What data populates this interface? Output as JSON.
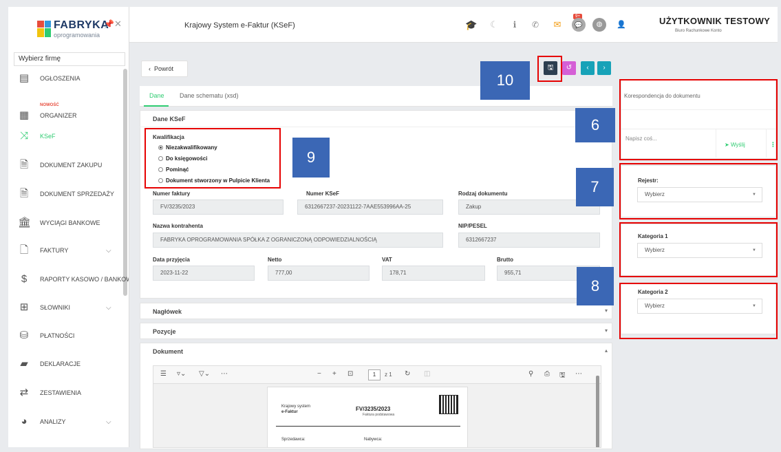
{
  "sidebar": {
    "logo_title": "FABRYKA",
    "logo_subtitle": "oprogramowania",
    "firm_select_placeholder": "Wybierz firmę",
    "items": [
      {
        "label": "OGŁOSZENIA",
        "icon": "newspaper-icon"
      },
      {
        "label": "ORGANIZER",
        "icon": "calendar-icon",
        "new_badge": "NOWOŚĆ"
      },
      {
        "label": "KSeF",
        "icon": "shuffle-icon"
      },
      {
        "label": "DOKUMENT ZAKUPU",
        "icon": "document-icon"
      },
      {
        "label": "DOKUMENT SPRZEDAŻY",
        "icon": "document-icon"
      },
      {
        "label": "WYCIĄGI BANKOWE",
        "icon": "bank-icon"
      },
      {
        "label": "FAKTURY",
        "icon": "file-icon"
      },
      {
        "label": "RAPORTY KASOWO / BANKOWE",
        "icon": "dollar-icon"
      },
      {
        "label": "SŁOWNIKI",
        "icon": "table-icon"
      },
      {
        "label": "PŁATNOŚCI",
        "icon": "coins-icon"
      },
      {
        "label": "DEKLARACJE",
        "icon": "book-icon"
      },
      {
        "label": "ZESTAWIENIA",
        "icon": "exchange-icon"
      },
      {
        "label": "ANALIZY",
        "icon": "pie-chart-icon"
      }
    ]
  },
  "header": {
    "title": "Krajowy System e-Faktur (KSeF)",
    "mail_badge": "9+",
    "user_name": "UŻYTKOWNIK TESTOWY",
    "user_subtitle": "Biuro Rachunkowe Konto"
  },
  "toolbar": {
    "back_label": "Powrót"
  },
  "tabs": [
    {
      "label": "Dane",
      "active": true
    },
    {
      "label": "Dane schematu (xsd)",
      "active": false
    }
  ],
  "ksef": {
    "section_title": "Dane KSeF",
    "kwalifikacja_label": "Kwalifikacja",
    "options": [
      {
        "label": "Niezakwalifikowany",
        "selected": true
      },
      {
        "label": "Do księgowości",
        "selected": false
      },
      {
        "label": "Pominąć",
        "selected": false
      },
      {
        "label": "Dokument stworzony w Pulpicie Klienta",
        "selected": false
      }
    ],
    "numer_faktury_label": "Numer faktury",
    "numer_faktury": "FV/3235/2023",
    "numer_ksef_label": "Numer KSeF",
    "numer_ksef": "6312667237-20231122-7AAE553996AA-25",
    "rodzaj_label": "Rodzaj dokumentu",
    "rodzaj": "Zakup",
    "kontrahent_label": "Nazwa kontrahenta",
    "kontrahent": "FABRYKA OPROGRAMOWANIA SPÓŁKA Z OGRANICZONĄ ODPOWIEDZIALNOŚCIĄ",
    "nip_label": "NIP/PESEL",
    "nip": "6312667237",
    "data_label": "Data przyjęcia",
    "data": "2023-11-22",
    "netto_label": "Netto",
    "netto": "777,00",
    "vat_label": "VAT",
    "vat": "178,71",
    "brutto_label": "Brutto",
    "brutto": "955,71"
  },
  "sections": {
    "naglowek": "Nagłówek",
    "pozycje": "Pozycje",
    "dokument": "Dokument"
  },
  "pdf": {
    "page_number": "1",
    "page_of": "z 1",
    "doc_type_line1": "Krajowy system",
    "doc_type_line2": "e-Faktur",
    "invoice_no": "FV/3235/2023",
    "invoice_kind": "Faktura podstawowa",
    "seller_label": "Sprzedawca:",
    "buyer_label": "Nabywca:"
  },
  "right": {
    "corr_title": "Korespondencja do dokumentu",
    "message_placeholder": "Napisz coś...",
    "send_label": "Wyślij",
    "rejestr_label": "Rejestr:",
    "rejestr_value": "Wybierz",
    "kat1_label": "Kategoria 1",
    "kat1_value": "Wybierz",
    "kat2_label": "Kategoria 2",
    "kat2_value": "Wybierz"
  },
  "annotations": [
    "10",
    "6",
    "9",
    "7",
    "8"
  ],
  "colors": {
    "accent": "#2ecc71",
    "annotation_red": "#e60000",
    "annotation_blue": "#3b67b5",
    "save_btn": "#2c3e50",
    "restore_btn": "#d55fd6",
    "nav_btn": "#17a2b8"
  }
}
